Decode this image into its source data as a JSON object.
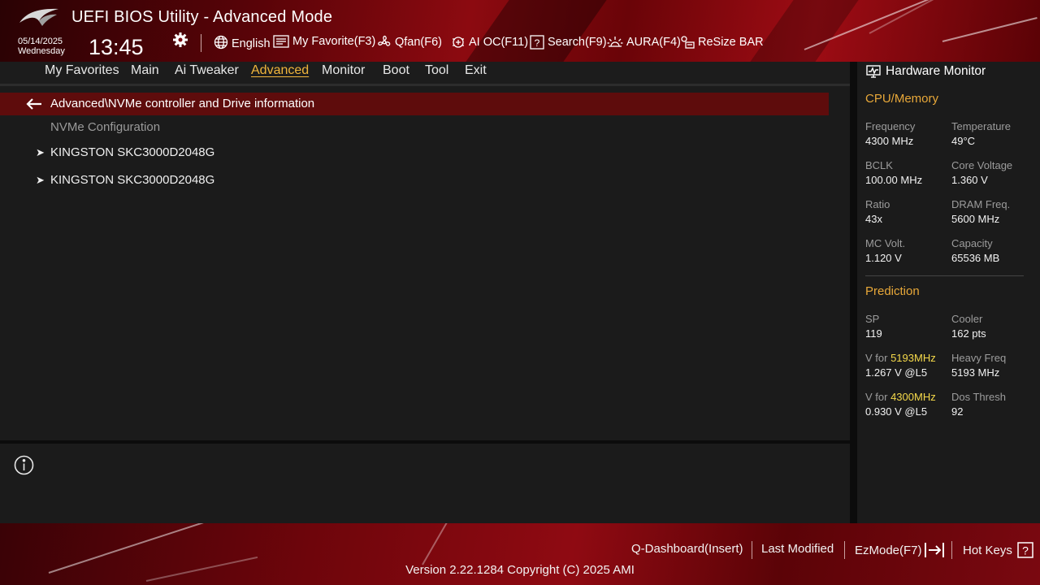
{
  "header": {
    "title": "UEFI BIOS Utility - Advanced Mode",
    "date": "05/14/2025",
    "weekday": "Wednesday",
    "time": "13:45",
    "tools": {
      "language": "English",
      "my_favorite": "My Favorite(F3)",
      "qfan": "Qfan(F6)",
      "ai_oc": "AI OC(F11)",
      "search": "Search(F9)",
      "aura": "AURA(F4)",
      "resize_bar": "ReSize BAR"
    }
  },
  "menu": {
    "tabs": [
      "My Favorites",
      "Main",
      "Ai Tweaker",
      "Advanced",
      "Monitor",
      "Boot",
      "Tool",
      "Exit"
    ],
    "active": "Advanced"
  },
  "main": {
    "breadcrumb": "Advanced\\NVMe controller and Drive information",
    "section_label": "NVMe Configuration",
    "drives": [
      "KINGSTON SKC3000D2048G",
      "KINGSTON SKC3000D2048G"
    ]
  },
  "hardware_monitor": {
    "title": "Hardware Monitor",
    "cpu_memory": {
      "heading": "CPU/Memory",
      "frequency_label": "Frequency",
      "frequency_value": "4300 MHz",
      "temperature_label": "Temperature",
      "temperature_value": "49°C",
      "bclk_label": "BCLK",
      "bclk_value": "100.00 MHz",
      "core_voltage_label": "Core Voltage",
      "core_voltage_value": "1.360 V",
      "ratio_label": "Ratio",
      "ratio_value": "43x",
      "dram_freq_label": "DRAM Freq.",
      "dram_freq_value": "5600 MHz",
      "mc_volt_label": "MC Volt.",
      "mc_volt_value": "1.120 V",
      "capacity_label": "Capacity",
      "capacity_value": "65536 MB"
    },
    "prediction": {
      "heading": "Prediction",
      "sp_label": "SP",
      "sp_value": "119",
      "cooler_label": "Cooler",
      "cooler_value": "162 pts",
      "v_for_prefix": "V for ",
      "v_for_1_freq": "5193MHz",
      "v_for_1_value": "1.267 V @L5",
      "heavy_freq_label": "Heavy Freq",
      "heavy_freq_value": "5193 MHz",
      "v_for_2_freq": "4300MHz",
      "v_for_2_value": "0.930 V @L5",
      "dos_thresh_label": "Dos Thresh",
      "dos_thresh_value": "92"
    }
  },
  "footer": {
    "q_dashboard": "Q-Dashboard(Insert)",
    "last_modified": "Last Modified",
    "ezmode": "EzMode(F7)",
    "hot_keys": "Hot Keys",
    "version": "Version 2.22.1284 Copyright (C) 2025 AMI"
  },
  "colors": {
    "accent_orange": "#e8a839",
    "highlight_yellow": "#f5d94a",
    "breadcrumb_red": "#5e0c0c",
    "header_red": "#8c0a10"
  },
  "icons": [
    "rog-logo-icon",
    "gear-icon",
    "globe-icon",
    "favorite-icon",
    "fan-icon",
    "ai-chip-icon",
    "search-icon",
    "aura-icon",
    "resize-bar-icon",
    "back-arrow-icon",
    "info-icon",
    "monitor-icon",
    "exit-arrow-icon",
    "help-icon"
  ]
}
